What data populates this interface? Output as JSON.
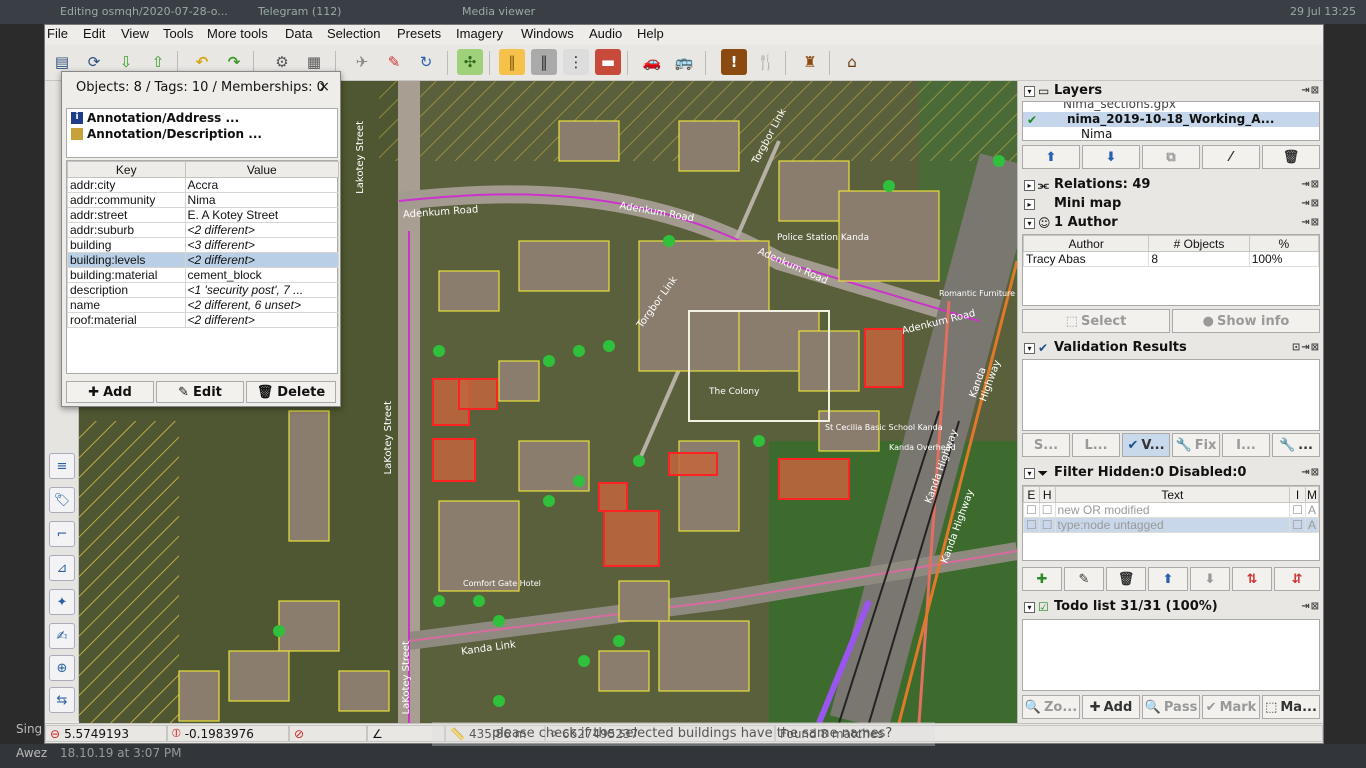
{
  "window": {
    "menu": [
      "File",
      "Edit",
      "View",
      "Tools",
      "More tools",
      "Data",
      "Selection",
      "Presets",
      "Imagery",
      "Windows",
      "Audio",
      "Help"
    ]
  },
  "desktop": {
    "tab_title_1": "Editing osmqh/2020-07-28-o...",
    "tab_title_2": "Telegram (112)",
    "tab_title_3": "Media viewer",
    "clock": "29 Jul 13:25",
    "chat_name": "Sing",
    "chat_author": "Awez",
    "chat_time": "18.10.19 at 3:07 PM",
    "toast_text": "please check if the selected buildings have the same names?"
  },
  "icons": {
    "toolbar": [
      "open-icon",
      "download-icon",
      "upload-icon",
      "save-icon",
      "undo-icon",
      "redo-icon",
      "preferences-icon",
      "map-paint-icon",
      "wireframe-icon",
      "refresh-icon",
      "tag-road-icon",
      "tag-lane-icon",
      "tag-traffic-light-icon",
      "tag-barrier-icon",
      "car-icon",
      "bus-icon",
      "hazard-icon",
      "restaurant-icon",
      "castle-icon",
      "factory-icon"
    ]
  },
  "properties": {
    "title": "Objects: 8 / Tags: 10 / Memberships: 0",
    "close": "×",
    "memberships": [
      "Annotation/Address ...",
      "Annotation/Description ..."
    ],
    "headers": {
      "key": "Key",
      "value": "Value"
    },
    "tags": [
      {
        "key": "addr:city",
        "value": "Accra",
        "italic": false
      },
      {
        "key": "addr:community",
        "value": "Nima",
        "italic": false
      },
      {
        "key": "addr:street",
        "value": "E. A Kotey Street",
        "italic": false
      },
      {
        "key": "addr:suburb",
        "value": "<2 different>",
        "italic": true
      },
      {
        "key": "building",
        "value": "<3 different>",
        "italic": true
      },
      {
        "key": "building:levels",
        "value": "<2 different>",
        "italic": true,
        "selected": true
      },
      {
        "key": "building:material",
        "value": "cement_block",
        "italic": false
      },
      {
        "key": "description",
        "value": "<1 'security post', 7 ...",
        "italic": true
      },
      {
        "key": "name",
        "value": "<2 different, 6 unset>",
        "italic": true
      },
      {
        "key": "roof:material",
        "value": "<2 different>",
        "italic": true
      }
    ],
    "buttons": {
      "add": "Add",
      "edit": "Edit",
      "delete": "Delete"
    }
  },
  "map": {
    "labels": [
      {
        "text": "Lakotey Street"
      },
      {
        "text": "Adenkum Road"
      },
      {
        "text": "Adenkum Road"
      },
      {
        "text": "Torgbor Link"
      },
      {
        "text": "Police Station Kanda"
      },
      {
        "text": "Adenkum Road"
      },
      {
        "text": "Torgbor Link"
      },
      {
        "text": "Romantic Furniture"
      },
      {
        "text": "Adenkum Road"
      },
      {
        "text": "The Colony"
      },
      {
        "text": "St Cecilia Basic School Kanda"
      },
      {
        "text": "Kanda Overhead"
      },
      {
        "text": "Kanda Highway"
      },
      {
        "text": "Kanda Highway"
      },
      {
        "text": "Kanda Highway"
      },
      {
        "text": "Comfort Gate Hotel"
      },
      {
        "text": "Kanda Link"
      },
      {
        "text": "LaKotey Street"
      },
      {
        "text": "LaKotey Street"
      }
    ]
  },
  "status": {
    "lat": "5.5749193",
    "lon": "-0.1983976",
    "distance": "435.86 m",
    "node_id": "6627495237",
    "matches": "Found 8 matches"
  },
  "layers": {
    "title": "Layers",
    "items": [
      "Nima_sections.gpx",
      "nima_2019-10-18_Working_A...",
      "Nima"
    ]
  },
  "relations": {
    "title": "Relations: 49"
  },
  "minimap": {
    "title": "Mini map"
  },
  "author": {
    "title": "1 Author",
    "headers": [
      "Author",
      "# Objects",
      "%"
    ],
    "row": [
      "Tracy Abas",
      "8",
      "100%"
    ],
    "select": "Select",
    "show_info": "Show info"
  },
  "validation": {
    "title": "Validation Results",
    "buttons": [
      "S...",
      "L...",
      "V...",
      "Fix",
      "I...",
      "..."
    ]
  },
  "filter": {
    "title": "Filter Hidden:0 Disabled:0",
    "headers": [
      "E",
      "H",
      "Text",
      "I",
      "M"
    ],
    "rows": [
      {
        "text": "new OR modified",
        "m": "A"
      },
      {
        "text": "type:node untagged",
        "m": "A"
      }
    ]
  },
  "todo": {
    "title": "Todo list 31/31 (100%)",
    "buttons": [
      "Zo...",
      "Add",
      "Pass",
      "Mark",
      "Ma..."
    ]
  }
}
